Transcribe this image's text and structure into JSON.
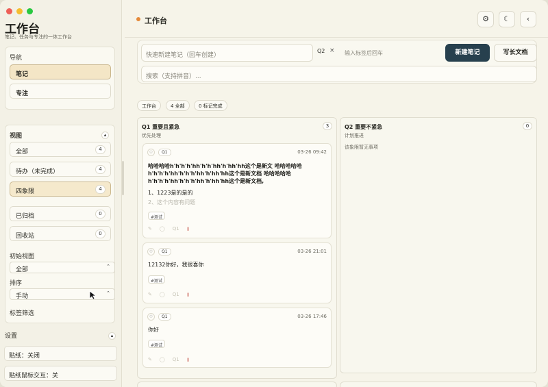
{
  "app": {
    "title": "工作台",
    "subtitle": "笔记、任务与专注的一体工作台"
  },
  "traffic_colors": {
    "close": "#ee5f57",
    "minimize": "#f5bd2f",
    "maximize": "#29c840"
  },
  "nav": {
    "heading": "导航",
    "items": [
      {
        "label": "笔记",
        "active": true
      },
      {
        "label": "专注",
        "active": false
      }
    ]
  },
  "views": {
    "heading": "视图",
    "toggle_icon": "chevron-up-icon",
    "items": [
      {
        "label": "全部",
        "count": "4"
      },
      {
        "label": "待办（未完成）",
        "count": "4"
      },
      {
        "label": "四象限",
        "count": "4"
      },
      {
        "label": "已归档",
        "count": "0"
      },
      {
        "label": "回收站",
        "count": "0"
      }
    ],
    "initial_view_label": "初始视图",
    "initial_view_value": "全部",
    "sort_label": "排序",
    "sort_value": "手动",
    "tag_filter_label": "标签筛选"
  },
  "settings": {
    "heading": "设置",
    "sticky": "贴纸：关闭",
    "sticky_mouse": "贴纸鼠标交互：关"
  },
  "header": {
    "title": "工作台",
    "accent": "#e58a3a",
    "icons": [
      "gear-icon",
      "moon-icon",
      "chevron-left-icon"
    ]
  },
  "composer": {
    "quick_placeholder": "快速新建笔记（回车创建）",
    "tag_chip": "Q2",
    "tag_remove": "×",
    "tag_placeholder": "输入标签后回车",
    "new_note": "新建笔记",
    "long_doc": "写长文档",
    "search_placeholder": "搜索（支持拼音）..."
  },
  "chips": [
    "工作台",
    "4 全部",
    "0 标记完成"
  ],
  "quadrants": [
    {
      "title": "Q1 重要且紧急",
      "subtitle": "优先处理",
      "count": "3"
    },
    {
      "title": "Q2 重要不紧急",
      "subtitle": "计划推进",
      "count": "0",
      "empty": "该象限暂无事项"
    }
  ],
  "cards": [
    {
      "quad": "Q1",
      "time": "03-26 09:42",
      "title_lines": [
        "哈哈哈哈h'h'h'h'hh'h'h'hh'h'hh'hh这个是新文 哈哈哈哈哈",
        "h'h'h'h'hh'h'h'h'hh'h'hh'hh这个是新文档 哈哈哈哈哈",
        "h'h'h'h'hh'h'h'h'hh'h'hh'hh这个是新文档,"
      ],
      "list": [
        "1、1223是的是的",
        "2、这个内容有问题"
      ],
      "tag": "#测试"
    },
    {
      "quad": "Q1",
      "time": "03-26 21:01",
      "text": "12132你好，我很喜你",
      "tag": "#测试"
    },
    {
      "quad": "Q1",
      "time": "03-26 17:46",
      "text": "你好",
      "tag": "#测试"
    }
  ]
}
